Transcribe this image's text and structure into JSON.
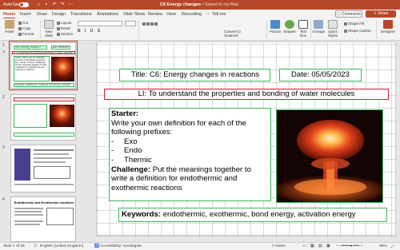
{
  "titlebar": {
    "autosave_label": "AutoSave",
    "toggle_state": "Off",
    "doc_title": "C6 Energy changes",
    "doc_status": "• Saved to my Mac",
    "accent": "#b7472a"
  },
  "tabs": [
    "Home",
    "Insert",
    "Draw",
    "Design",
    "Transitions",
    "Animations",
    "Slide Show",
    "Review",
    "View",
    "Recording"
  ],
  "tell_me": "Tell me",
  "actions": {
    "comments": "Comments",
    "share": "Share"
  },
  "ribbon": {
    "paste": "Paste",
    "cut": "Cut",
    "copy": "Copy",
    "format": "Format",
    "new_slide": "New Slide",
    "layout": "Layout",
    "reset": "Reset",
    "section": "Section",
    "convert": "Convert to SmartArt",
    "picture": "Picture",
    "shapes": "Shapes",
    "text_box": "Text Box",
    "arrange": "Arrange",
    "quick_styles": "Quick Styles",
    "shape_fill": "Shape Fill",
    "shape_outline": "Shape Outline",
    "designer": "Designer"
  },
  "thumbnails": [
    {
      "number": "1",
      "title": "Title: C6 Energy changes in reactions",
      "date": "Date: 05/05/2023",
      "li": "LI: To understand the properties and bonding of water molecules",
      "starter": "Starter: Write your own definition for each of the following prefixes: - Exo - Endo - Thermic. Challenge: Put the meanings together to write a definition for endothermic and exothermic reactions",
      "keywords": "Keywords: endothermic, exothermic, bond energy, activation energy"
    },
    {
      "number": "2"
    },
    {
      "number": "3"
    },
    {
      "number": "4",
      "heading": "Endothermic and Exothermic reactions"
    }
  ],
  "slide": {
    "title": "Title: C6: Energy changes in reactions",
    "date": "Date: 05/05/2023",
    "li": "LI: To understand the properties and bonding of water molecules",
    "starter_label": "Starter:",
    "starter_text": "Write your own definition for each of the following prefixes:",
    "prefixes": [
      "Exo",
      "Endo",
      "Thermic"
    ],
    "challenge_label": "Challenge:",
    "challenge_text": "Put the meanings together to write a definition for endothermic and exothermic reactions",
    "keywords_label": "Keywords:",
    "keywords_text": "endothermic, exothermic, bond energy, activation energy"
  },
  "status": {
    "slide": "Slide 1 of 28",
    "language": "English (United Kingdom)",
    "accessibility": "Accessibility: Investigate",
    "zoom": "98%"
  }
}
